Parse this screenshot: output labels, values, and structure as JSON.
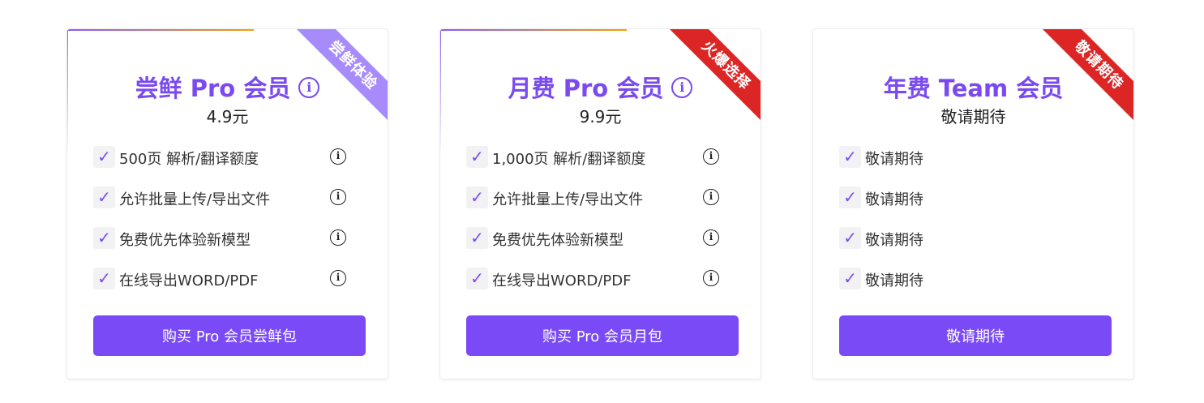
{
  "colors": {
    "brand": "#7a4af7",
    "ribbon_purple": "#a78bfa",
    "ribbon_red": "#dc2626"
  },
  "cards": [
    {
      "ribbon": "尝鲜体验",
      "title": "尝鲜 Pro 会员",
      "title_info_icon": "info-circle-icon",
      "price": "4.9元",
      "features": [
        {
          "text": "500页 解析/翻译额度"
        },
        {
          "text": "允许批量上传/导出文件"
        },
        {
          "text": "免费优先体验新模型"
        },
        {
          "text": "在线导出WORD/PDF"
        }
      ],
      "button": "购买 Pro 会员尝鲜包"
    },
    {
      "ribbon": "火爆选择",
      "title": "月费 Pro 会员",
      "title_info_icon": "info-circle-icon",
      "price": "9.9元",
      "features": [
        {
          "text": "1,000页 解析/翻译额度"
        },
        {
          "text": "允许批量上传/导出文件"
        },
        {
          "text": "免费优先体验新模型"
        },
        {
          "text": "在线导出WORD/PDF"
        }
      ],
      "button": "购买 Pro 会员月包"
    },
    {
      "ribbon": "敬请期待",
      "title": "年费 Team 会员",
      "price": "敬请期待",
      "features": [
        {
          "text": "敬请期待"
        },
        {
          "text": "敬请期待"
        },
        {
          "text": "敬请期待"
        },
        {
          "text": "敬请期待"
        }
      ],
      "button": "敬请期待"
    }
  ]
}
